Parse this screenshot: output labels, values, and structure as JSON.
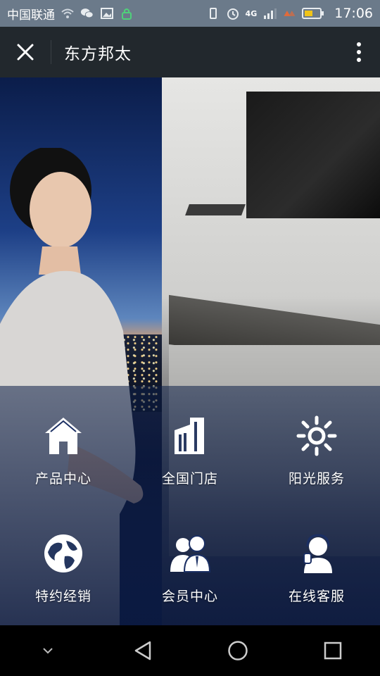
{
  "status_bar": {
    "carrier": "中国联通",
    "network": "4G",
    "time": "17:06"
  },
  "title_bar": {
    "title": "东方邦太"
  },
  "menu": [
    {
      "label": "产品中心",
      "icon": "house-icon"
    },
    {
      "label": "全国门店",
      "icon": "building-icon"
    },
    {
      "label": "阳光服务",
      "icon": "sun-icon"
    },
    {
      "label": "特约经销",
      "icon": "globe-icon"
    },
    {
      "label": "会员中心",
      "icon": "members-icon"
    },
    {
      "label": "在线客服",
      "icon": "headset-icon"
    }
  ],
  "colors": {
    "status_bar": "#6b7a8a",
    "title_bar": "#22282d",
    "nav_bar": "#000000"
  }
}
